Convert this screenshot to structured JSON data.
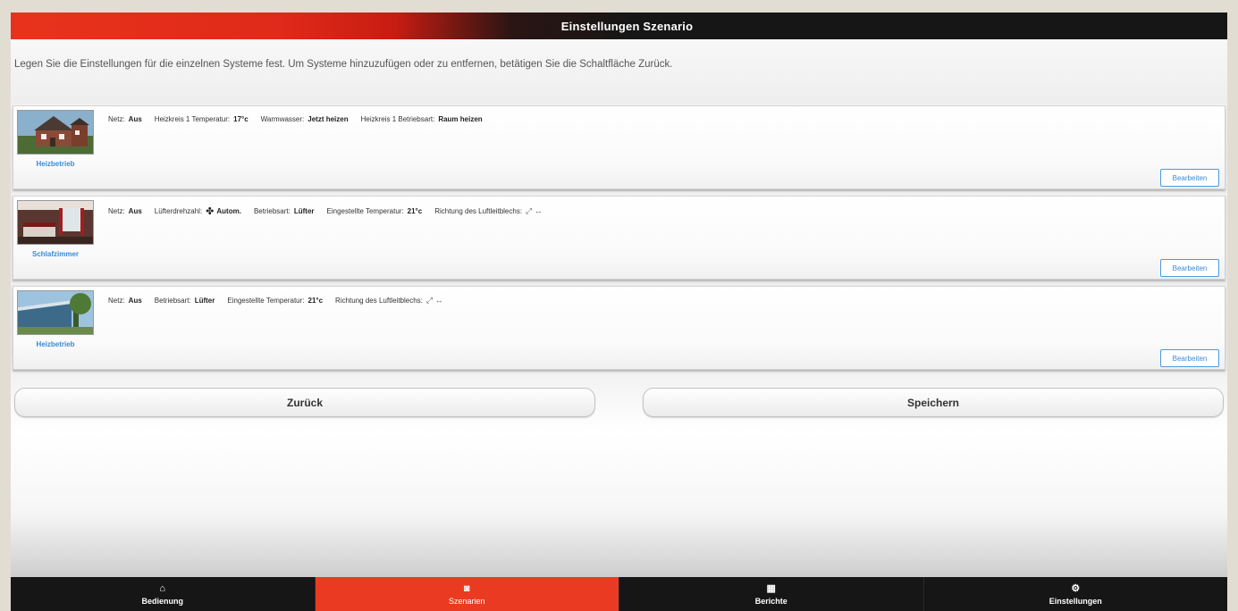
{
  "header": {
    "title": "Einstellungen Szenario"
  },
  "intro": "Legen Sie die Einstellungen für die einzelnen Systeme fest. Um Systeme hinzuzufügen oder zu entfernen, betätigen Sie die Schaltfläche Zurück.",
  "cards": [
    {
      "name": "Heizbetrieb",
      "settings": [
        {
          "key": "Netz:",
          "value": "Aus"
        },
        {
          "key": "Heizkreis 1 Temperatur:",
          "value": "17°c"
        },
        {
          "key": "Warmwasser:",
          "value": "Jetzt heizen"
        },
        {
          "key": "Heizkreis 1 Betriebsart:",
          "value": "Raum heizen"
        }
      ],
      "edit_label": "Bearbeiten"
    },
    {
      "name": "Schlafzimmer",
      "settings": [
        {
          "key": "Netz:",
          "value": "Aus"
        },
        {
          "key": "Lüfterdrehzahl:",
          "value": "Autom."
        },
        {
          "key": "Betriebsart:",
          "value": "Lüfter"
        },
        {
          "key": "Eingestellte Temperatur:",
          "value": "21°c"
        },
        {
          "key": "Richtung des Luftleitblechs:",
          "value": ""
        }
      ],
      "edit_label": "Bearbeiten"
    },
    {
      "name": "Heizbetrieb",
      "settings": [
        {
          "key": "Netz:",
          "value": "Aus"
        },
        {
          "key": "Betriebsart:",
          "value": "Lüfter"
        },
        {
          "key": "Eingestellte Temperatur:",
          "value": "21°c"
        },
        {
          "key": "Richtung des Luftleitblechs:",
          "value": ""
        }
      ],
      "edit_label": "Bearbeiten"
    }
  ],
  "buttons": {
    "back": "Zurück",
    "save": "Speichern"
  },
  "tabs": [
    {
      "label": "Bedienung",
      "icon": "home-icon"
    },
    {
      "label": "Szenarien",
      "icon": "scenario-icon",
      "active": true
    },
    {
      "label": "Berichte",
      "icon": "grid-icon"
    },
    {
      "label": "Einstellungen",
      "icon": "gear-icon"
    }
  ],
  "colors": {
    "accent": "#ea3b22",
    "link": "#3a8bd6",
    "tabbar": "#161616"
  }
}
